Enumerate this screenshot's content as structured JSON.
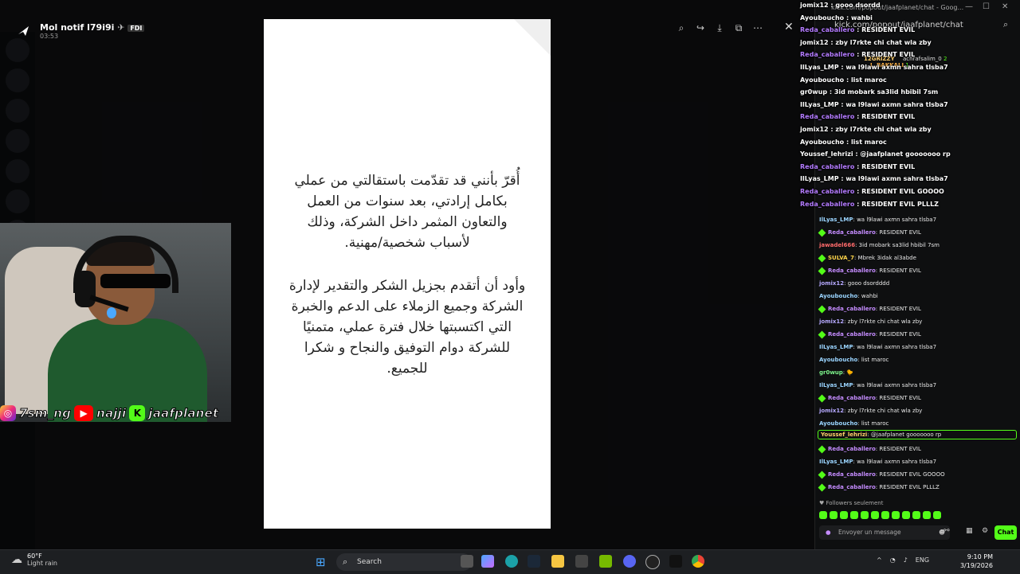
{
  "viewer": {
    "title": "Mol notif l79i9i",
    "badge": "FDI",
    "time": "03:53",
    "tools": [
      "zoom-icon",
      "forward-icon",
      "download-icon",
      "open-external-icon",
      "more-icon"
    ],
    "close": "✕"
  },
  "letter": {
    "paragraph1": "أُقرّ بأنني قد تقدّمت باستقالتي من عملي بكامل إرادتي، بعد سنوات من العمل والتعاون المثمر داخل الشركة، وذلك لأسباب شخصية/مهنية.",
    "paragraph2": "وأود أن أتقدم بجزيل الشكر والتقدير لإدارة الشركة وجميع الزملاء على الدعم والخبرة التي اكتسبتها خلال فترة عملي، متمنيًا للشركة دوام التوفيق والنجاح و شكرا للجميع."
  },
  "socials": {
    "instagram": "7sm_ng",
    "youtube": "najji",
    "kick": "jaafplanet"
  },
  "browser": {
    "url": "kick.com/popout/jaafplanet/chat",
    "tab_title": "kick.com/popout/jaafplanet/chat - Goog..."
  },
  "leaderboard": {
    "top1": "12GRIZZY",
    "top2": "achrafsalim_0",
    "top2_count": "2",
    "top3": "L_BAKKALI",
    "top3_count": "1"
  },
  "overlay_chat": [
    {
      "user": "jomix12",
      "text": "gooo dsordd"
    },
    {
      "user": "Ayouboucho",
      "text": "wahbi"
    },
    {
      "user": "Reda_caballero",
      "text": "RESIDENT EVIL"
    },
    {
      "user": "jomix12",
      "text": "zby l7rkte chi chat wla zby"
    },
    {
      "user": "Reda_caballero",
      "text": "RESIDENT EVIL"
    },
    {
      "user": "IlLyas_LMP",
      "text": "wa l9lawi axmn sahra tlsba7"
    },
    {
      "user": "Ayouboucho",
      "text": "list maroc"
    },
    {
      "user": "gr0wup",
      "text": "3id mobark sa3lid hbibil 7sm"
    },
    {
      "user": "IlLyas_LMP",
      "text": "wa l9lawi axmn sahra tlsba7"
    },
    {
      "user": "Reda_caballero",
      "text": "RESIDENT EVIL"
    },
    {
      "user": "jomix12",
      "text": "zby l7rkte chi chat wla zby"
    },
    {
      "user": "Ayouboucho",
      "text": "list maroc"
    },
    {
      "user": "Youssef_lehrizi",
      "text": "@jaafplanet gooooooo rp"
    },
    {
      "user": "Reda_caballero",
      "text": "RESIDENT EVIL"
    },
    {
      "user": "IlLyas_LMP",
      "text": "wa l9lawi axmn sahra tlsba7"
    },
    {
      "user": "Reda_caballero",
      "text": "RESIDENT EVIL GOOOO"
    },
    {
      "user": "Reda_caballero",
      "text": "RESIDENT EVIL PLLLZ"
    }
  ],
  "chat": [
    {
      "user": "IlLyas_LMP",
      "text": "wa l9lawi axmn sahra tlsba7",
      "color": "#9ad4ff"
    },
    {
      "user": "Reda_caballero",
      "text": "RESIDENT EVIL",
      "color": "#c58cff",
      "badge": true
    },
    {
      "user": "jawadel666",
      "text": "3id mobark sa3lid hbibil 7sm",
      "color": "#ff6b6b"
    },
    {
      "user": "SULVA_7",
      "text": "Mbrek 3idak al3abde",
      "color": "#ffd54a",
      "badge": true
    },
    {
      "user": "Reda_caballero",
      "text": "RESIDENT EVIL",
      "color": "#c58cff",
      "badge": true
    },
    {
      "user": "jomix12",
      "text": "gooo dsordddd",
      "color": "#b6a9ff"
    },
    {
      "user": "Ayouboucho",
      "text": "wahbi",
      "color": "#9ad4ff"
    },
    {
      "user": "Reda_caballero",
      "text": "RESIDENT EVIL",
      "color": "#c58cff",
      "badge": true
    },
    {
      "user": "jomix12",
      "text": "zby l7rkte chi chat wla zby",
      "color": "#b6a9ff"
    },
    {
      "user": "Reda_caballero",
      "text": "RESIDENT EVIL",
      "color": "#c58cff",
      "badge": true
    },
    {
      "user": "IlLyas_LMP",
      "text": "wa l9lawi axmn sahra tlsba7",
      "color": "#9ad4ff"
    },
    {
      "user": "Ayouboucho",
      "text": "list maroc",
      "color": "#9ad4ff"
    },
    {
      "user": "gr0wup",
      "text": "🐤",
      "color": "#7cf28a"
    },
    {
      "user": "IlLyas_LMP",
      "text": "wa l9lawi axmn sahra tlsba7",
      "color": "#9ad4ff"
    },
    {
      "user": "Reda_caballero",
      "text": "RESIDENT EVIL",
      "color": "#c58cff",
      "badge": true
    },
    {
      "user": "jomix12",
      "text": "zby l7rkte chi chat wla zby",
      "color": "#b6a9ff"
    },
    {
      "user": "Ayouboucho",
      "text": "list maroc",
      "color": "#9ad4ff"
    },
    {
      "user": "Youssef_lehrizi",
      "text": "@jaafplanet gooooooo rp",
      "color": "#ffcf6b",
      "highlight": true
    },
    {
      "user": "Reda_caballero",
      "text": "RESIDENT EVIL",
      "color": "#c58cff",
      "badge": true
    },
    {
      "user": "IlLyas_LMP",
      "text": "wa l9lawi axmn sahra tlsba7",
      "color": "#9ad4ff"
    },
    {
      "user": "Reda_caballero",
      "text": "RESIDENT EVIL GOOOO",
      "color": "#c58cff",
      "badge": true
    },
    {
      "user": "Reda_caballero",
      "text": "RESIDENT EVIL PLLLZ",
      "color": "#c58cff",
      "badge": true
    }
  ],
  "chat_footer": {
    "followers": "Followers seulement",
    "placeholder": "Envoyer un message",
    "send": "Chat"
  },
  "taskbar": {
    "temp": "60°F",
    "weather": "Light rain",
    "search": "Search",
    "lang": "ENG",
    "time": "9:10 PM",
    "date": "3/19/2026"
  },
  "colors": {
    "kick_green": "#53fc18",
    "accent_blue": "#4aa8ff"
  }
}
